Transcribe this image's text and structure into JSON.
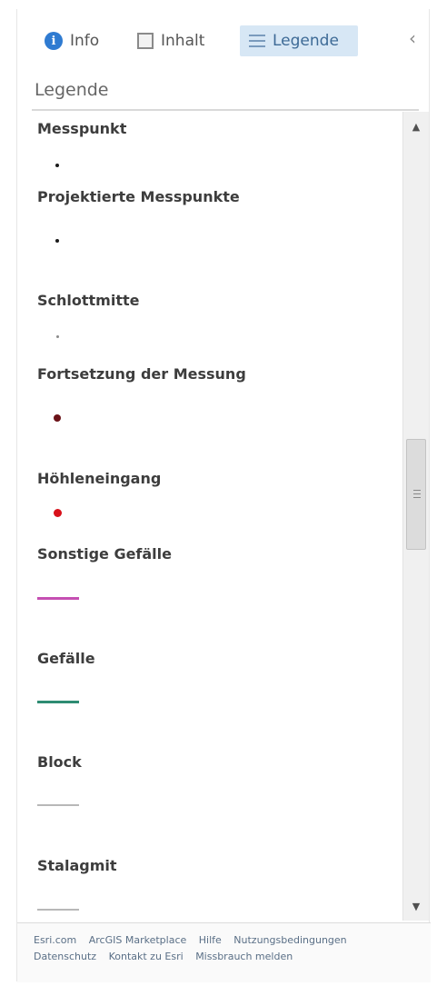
{
  "tabs": {
    "info": "Info",
    "inhalt": "Inhalt",
    "legende": "Legende",
    "active": "legende",
    "accent_bg": "#d7e7f5",
    "accent_text": "#3d6a96"
  },
  "icons": {
    "info": "info-circle-icon",
    "inhalt": "table-of-contents-icon",
    "legende": "legend-list-icon",
    "collapse": "chevron-left-icon",
    "scroll_up": "arrow-up-icon",
    "scroll_down": "arrow-down-icon"
  },
  "panel_title": "Legende",
  "legend": {
    "items": [
      {
        "label": "Messpunkt",
        "symbol": "dot",
        "color": "#1a1a1a"
      },
      {
        "label": "Projektierte Messpunkte",
        "symbol": "dot",
        "color": "#1a1a1a"
      },
      {
        "label": "Schlottmitte",
        "symbol": "dot",
        "color": "#8a8a8a"
      },
      {
        "label": "Fortsetzung der Messung",
        "symbol": "dot",
        "color": "#6b1218"
      },
      {
        "label": "Höhleneingang",
        "symbol": "dot",
        "color": "#d8111a"
      },
      {
        "label": "Sonstige Gefälle",
        "symbol": "line",
        "color": "#c54fb2"
      },
      {
        "label": "Gefälle",
        "symbol": "line",
        "color": "#2e8c72"
      },
      {
        "label": "Block",
        "symbol": "line",
        "color": "#b8b8b8"
      },
      {
        "label": "Stalagmit",
        "symbol": "line",
        "color": "#b8b8b8"
      }
    ]
  },
  "footer": {
    "links": [
      "Esri.com",
      "ArcGIS Marketplace",
      "Hilfe",
      "Nutzungsbedingungen",
      "Datenschutz",
      "Kontakt zu Esri",
      "Missbrauch melden"
    ]
  }
}
